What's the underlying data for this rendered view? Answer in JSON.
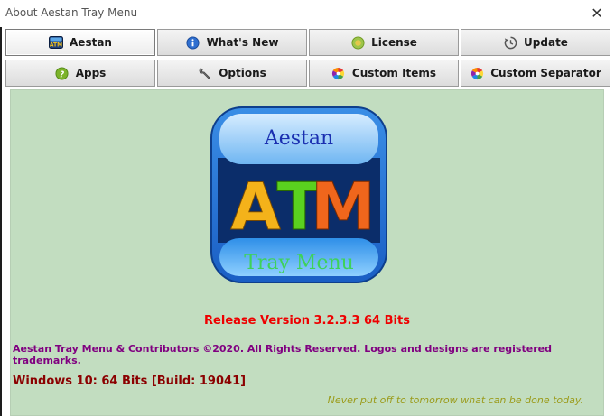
{
  "window": {
    "title": "About Aestan Tray Menu",
    "close_glyph": "✕"
  },
  "tabs": [
    {
      "label": "Aestan",
      "icon": "atm-logo-icon",
      "active": true
    },
    {
      "label": "What's New",
      "icon": "info-icon",
      "active": false
    },
    {
      "label": "License",
      "icon": "license-badge-icon",
      "active": false
    },
    {
      "label": "Update",
      "icon": "update-clock-icon",
      "active": false
    },
    {
      "label": "Apps",
      "icon": "help-icon",
      "active": false
    },
    {
      "label": "Options",
      "icon": "wrench-icon",
      "active": false
    },
    {
      "label": "Custom Items",
      "icon": "color-wheel-icon",
      "active": false
    },
    {
      "label": "Custom Separator",
      "icon": "color-wheel-icon",
      "active": false
    }
  ],
  "logo": {
    "top_text": "Aestan",
    "letters": [
      "A",
      "T",
      "M"
    ],
    "bottom_text": "Tray Menu"
  },
  "content": {
    "release": "Release Version 3.2.3.3 64 Bits",
    "copyright": "Aestan Tray Menu & Contributors ©2020. All Rights Reserved. Logos and designs are registered trademarks.",
    "windows": "Windows 10: 64 Bits [Build: 19041]",
    "quote": "Never put off to tomorrow what can be done today."
  },
  "colors": {
    "content_bg": "#c2ddc0",
    "release": "#ee0000",
    "copyright": "#800080",
    "windows": "#8b0000",
    "quote": "#9b9b1a"
  }
}
